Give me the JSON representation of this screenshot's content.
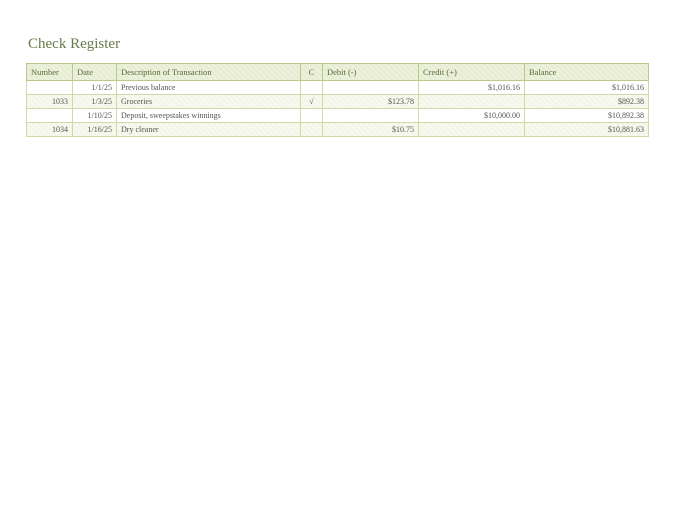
{
  "title": "Check Register",
  "columns": {
    "number": "Number",
    "date": "Date",
    "description": "Description of Transaction",
    "c": "C",
    "debit": "Debit  (-)",
    "credit": "Credit (+)",
    "balance": "Balance"
  },
  "rows": [
    {
      "number": "",
      "date": "1/1/25",
      "description": "Previous balance",
      "c": "",
      "debit": "",
      "credit": "$1,016.16",
      "balance": "$1,016.16"
    },
    {
      "number": "1033",
      "date": "1/3/25",
      "description": "Groceries",
      "c": "√",
      "debit": "$123.78",
      "credit": "",
      "balance": "$892.38"
    },
    {
      "number": "",
      "date": "1/10/25",
      "description": "Deposit, sweepstakes winnings",
      "c": "",
      "debit": "",
      "credit": "$10,000.00",
      "balance": "$10,892.38"
    },
    {
      "number": "1034",
      "date": "1/16/25",
      "description": "Dry cleaner",
      "c": "",
      "debit": "$10.75",
      "credit": "",
      "balance": "$10,881.63"
    }
  ]
}
